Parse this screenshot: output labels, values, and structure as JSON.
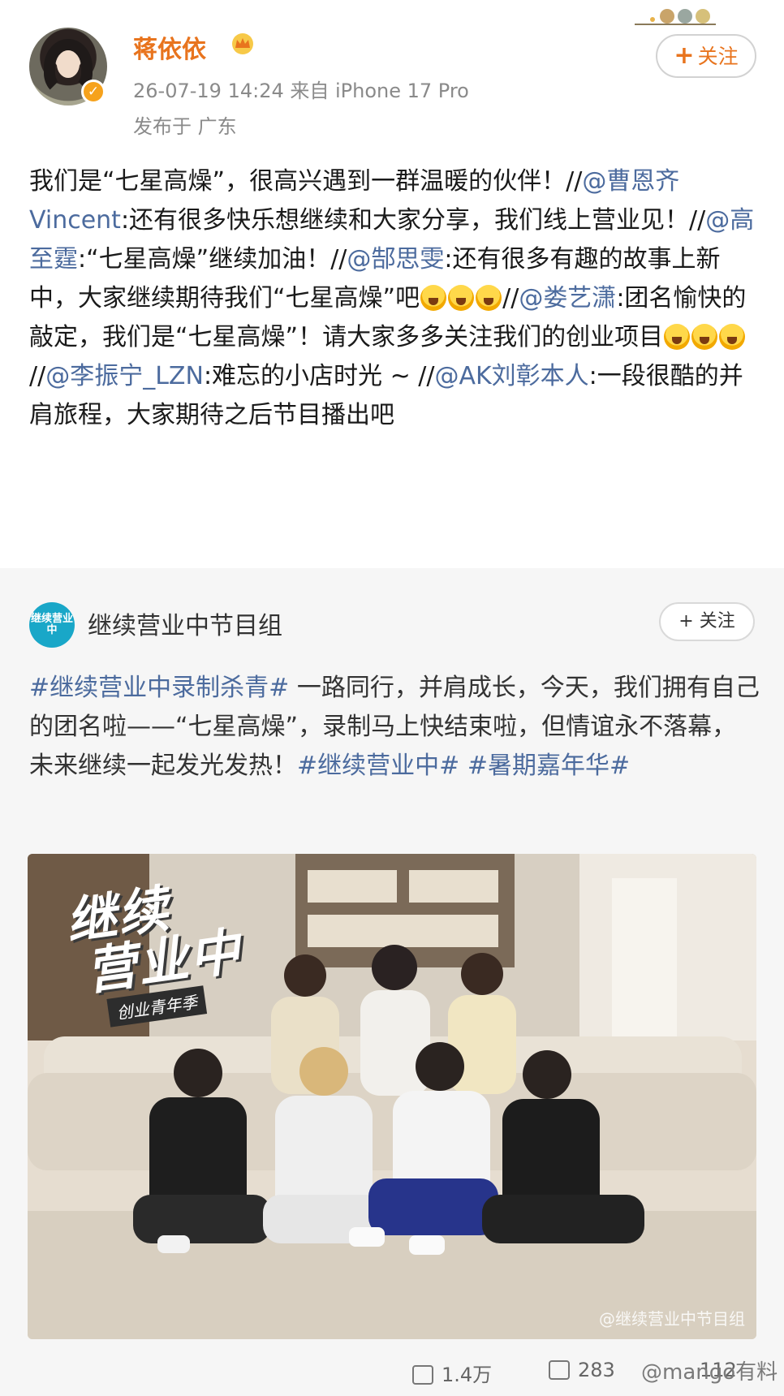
{
  "header": {
    "username": "蒋依依",
    "meta": "26-07-19 14:24 来自 iPhone 17 Pro",
    "location": "发布于 广东",
    "follow_label": "关注",
    "follow_plus": "+"
  },
  "post": {
    "p1": "我们是“七星高燥”，很高兴遇到一群温暖的伙伴！//",
    "m1": "@曹恩齐Vincent",
    "p2": ":还有很多快乐想继续和大家分享，我们线上营业见！//",
    "m2": "@高至霆",
    "p3": ":“七星高燥”继续加油！//",
    "m3": "@郜思雯",
    "p4": ":还有很多有趣的故事上新中，大家继续期待我们“七星高燥”吧",
    "p5": "//",
    "m4": "@娄艺潇",
    "p6": ":团名愉快的敲定，我们是“七星高燥”！请大家多多关注我们的创业项目",
    "p7": "//",
    "m5": "@李振宁_LZN",
    "p8": ":难忘的小店时光 ~ //",
    "m6": "@AK刘彰本人",
    "p9": ":一段很酷的并肩旅程，大家期待之后节目播出吧"
  },
  "repost": {
    "logo_text": "继续营业中",
    "name": "继续营业中节目组",
    "follow_label": "+ 关注",
    "topic1": "#继续营业中录制杀青#",
    "body": " 一路同行，并肩成长，今天，我们拥有自己的团名啦——“七星高燥”，录制马上快结束啦，但情谊永不落幕，未来继续一起发光发热！",
    "topic2": "#继续营业中#",
    "topic3": "#暑期嘉年华#"
  },
  "photo": {
    "logo_line1": "继续",
    "logo_line2": "营业中",
    "logo_tag": "创业青年季",
    "watermark": "@继续营业中节目组"
  },
  "footer": {
    "reposts": "1.4万",
    "comments": "283",
    "likes": "112",
    "overlay_watermark": "@mango有料"
  },
  "colors": {
    "username": "#e8741e",
    "link": "#4c6b9e",
    "meta": "#8a8a8a",
    "repost_bg": "#f6f6f6"
  }
}
